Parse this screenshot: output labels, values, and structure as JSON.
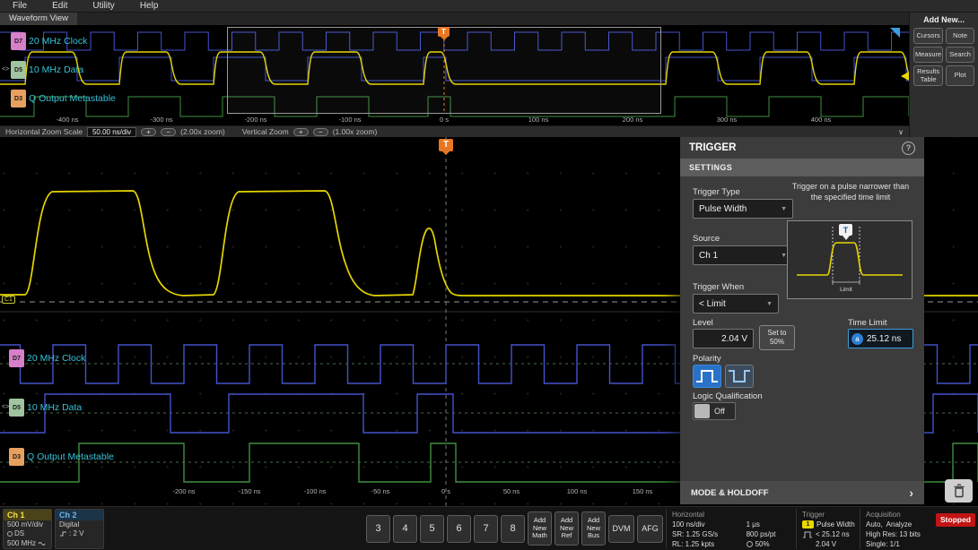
{
  "menu": {
    "items": [
      "File",
      "Edit",
      "Utility",
      "Help"
    ]
  },
  "view_title": "Waveform View",
  "add_new": {
    "title": "Add New...",
    "buttons": [
      "Cursors",
      "Note",
      "Measure",
      "Search",
      "Results Table",
      "Plot"
    ]
  },
  "overview": {
    "channels": [
      {
        "badge": "D7",
        "label": "20 MHz Clock",
        "color": "#d77fc8",
        "handle": false
      },
      {
        "badge": "D5",
        "label": "10 MHz Data",
        "color": "#9fc49f",
        "handle": true
      },
      {
        "badge": "D3",
        "label": "Q Output Metastable",
        "color": "#e8a05e",
        "handle": false
      }
    ],
    "time_labels": [
      "-400 ns",
      "-300 ns",
      "-200 ns",
      "-100 ns",
      "0 s",
      "100 ns",
      "200 ns",
      "300 ns",
      "400 ns"
    ]
  },
  "zoom_bar": {
    "h_label": "Horizontal Zoom Scale",
    "h_value": "50.00 ns/div",
    "h_zoom": "(2.00x zoom)",
    "v_label": "Vertical Zoom",
    "v_zoom": "(1.00x zoom)",
    "plus": "+",
    "minus": "−",
    "collapse": "∨"
  },
  "main_view": {
    "trigger_flag": "T",
    "ch1_marker": "C1",
    "time_labels": [
      "-200 ns",
      "-150 ns",
      "-100 ns",
      "-50 ns",
      "0 s",
      "50 ns",
      "100 ns",
      "150 ns"
    ]
  },
  "trigger_panel": {
    "title": "TRIGGER",
    "settings_tab": "SETTINGS",
    "trigger_type_label": "Trigger Type",
    "trigger_type_value": "Pulse Width",
    "description": "Trigger on a pulse narrower than the specified time limit",
    "source_label": "Source",
    "source_value": "Ch 1",
    "trigger_when_label": "Trigger When",
    "trigger_when_value": "< Limit",
    "diagram_limit_label": "Limit",
    "diagram_flag": "T",
    "level_label": "Level",
    "level_value": "2.04 V",
    "set_to_label": "Set to 50%",
    "time_limit_label": "Time Limit",
    "time_limit_value": "25.12 ns",
    "polarity_label": "Polarity",
    "logic_label": "Logic Qualification",
    "logic_value": "Off",
    "mode_holdoff_label": "MODE & HOLDOFF"
  },
  "status_bar": {
    "ch1": {
      "name": "Ch 1",
      "line1": "500 mV/div",
      "line2": "DS",
      "line3": "500 MHz"
    },
    "ch2": {
      "name": "Ch 2",
      "line1": "Digital",
      "line2": ": 2 V"
    },
    "channel_buttons": [
      "3",
      "4",
      "5",
      "6",
      "7",
      "8"
    ],
    "add_buttons": [
      [
        "Add",
        "New",
        "Math"
      ],
      [
        "Add",
        "New",
        "Ref"
      ],
      [
        "Add",
        "New",
        "Bus"
      ]
    ],
    "dvm_label": "DVM",
    "afg_label": "AFG",
    "horizontal": {
      "title": "Horizontal",
      "rows": [
        [
          "100 ns/div",
          "1 μs"
        ],
        [
          "SR: 1.25 GS/s",
          "800 ps/pt"
        ],
        [
          "RL: 1.25 kpts",
          "50%"
        ]
      ]
    },
    "trigger": {
      "title": "Trigger",
      "rows": [
        "Pulse Width",
        "< 25.12 ns",
        "2.04 V"
      ]
    },
    "acquisition": {
      "title": "Acquisition",
      "rows": [
        "Auto,  Analyze",
        "High Res: 13 bits",
        "Single: 1/1"
      ]
    },
    "stopped_label": "Stopped"
  }
}
